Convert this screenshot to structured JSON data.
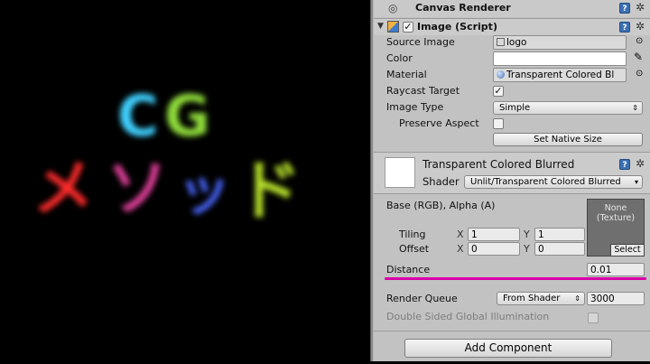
{
  "scene": {
    "title_line": "CG",
    "subtitle_line": "メソッド",
    "colors": {
      "c": "#3fd0ff",
      "g": "#8fdc3a",
      "me": "#ff2a2a",
      "so": "#e0409a",
      "tsu": "#4a66ff",
      "do": "#b7e02a"
    }
  },
  "canvas_renderer": {
    "title": "Canvas Renderer"
  },
  "image_script": {
    "title": "Image (Script)",
    "source_image_label": "Source Image",
    "source_image_value": "logo",
    "color_label": "Color",
    "material_label": "Material",
    "material_value": "Transparent Colored Bl",
    "raycast_label": "Raycast Target",
    "raycast_checked": true,
    "image_type_label": "Image Type",
    "image_type_value": "Simple",
    "preserve_aspect_label": "Preserve Aspect",
    "preserve_aspect_checked": false,
    "set_native_size": "Set Native Size"
  },
  "material_panel": {
    "name": "Transparent Colored Blurred",
    "shader_label": "Shader",
    "shader_value": "Unlit/Transparent Colored Blurred",
    "base_label": "Base (RGB), Alpha (A)",
    "tiling_label": "Tiling",
    "offset_label": "Offset",
    "tiling_x": "1",
    "tiling_y": "1",
    "offset_x": "0",
    "offset_y": "0",
    "x_label": "X",
    "y_label": "Y",
    "texture_none": "None",
    "texture_type": "(Texture)",
    "select_label": "Select",
    "distance_label": "Distance",
    "distance_value": "0.01",
    "highlight_color": "#d800a8",
    "render_queue_label": "Render Queue",
    "render_queue_mode": "From Shader",
    "render_queue_value": "3000",
    "double_sided_label": "Double Sided Global Illumination",
    "double_sided_checked": false
  },
  "add_component": "Add Component"
}
